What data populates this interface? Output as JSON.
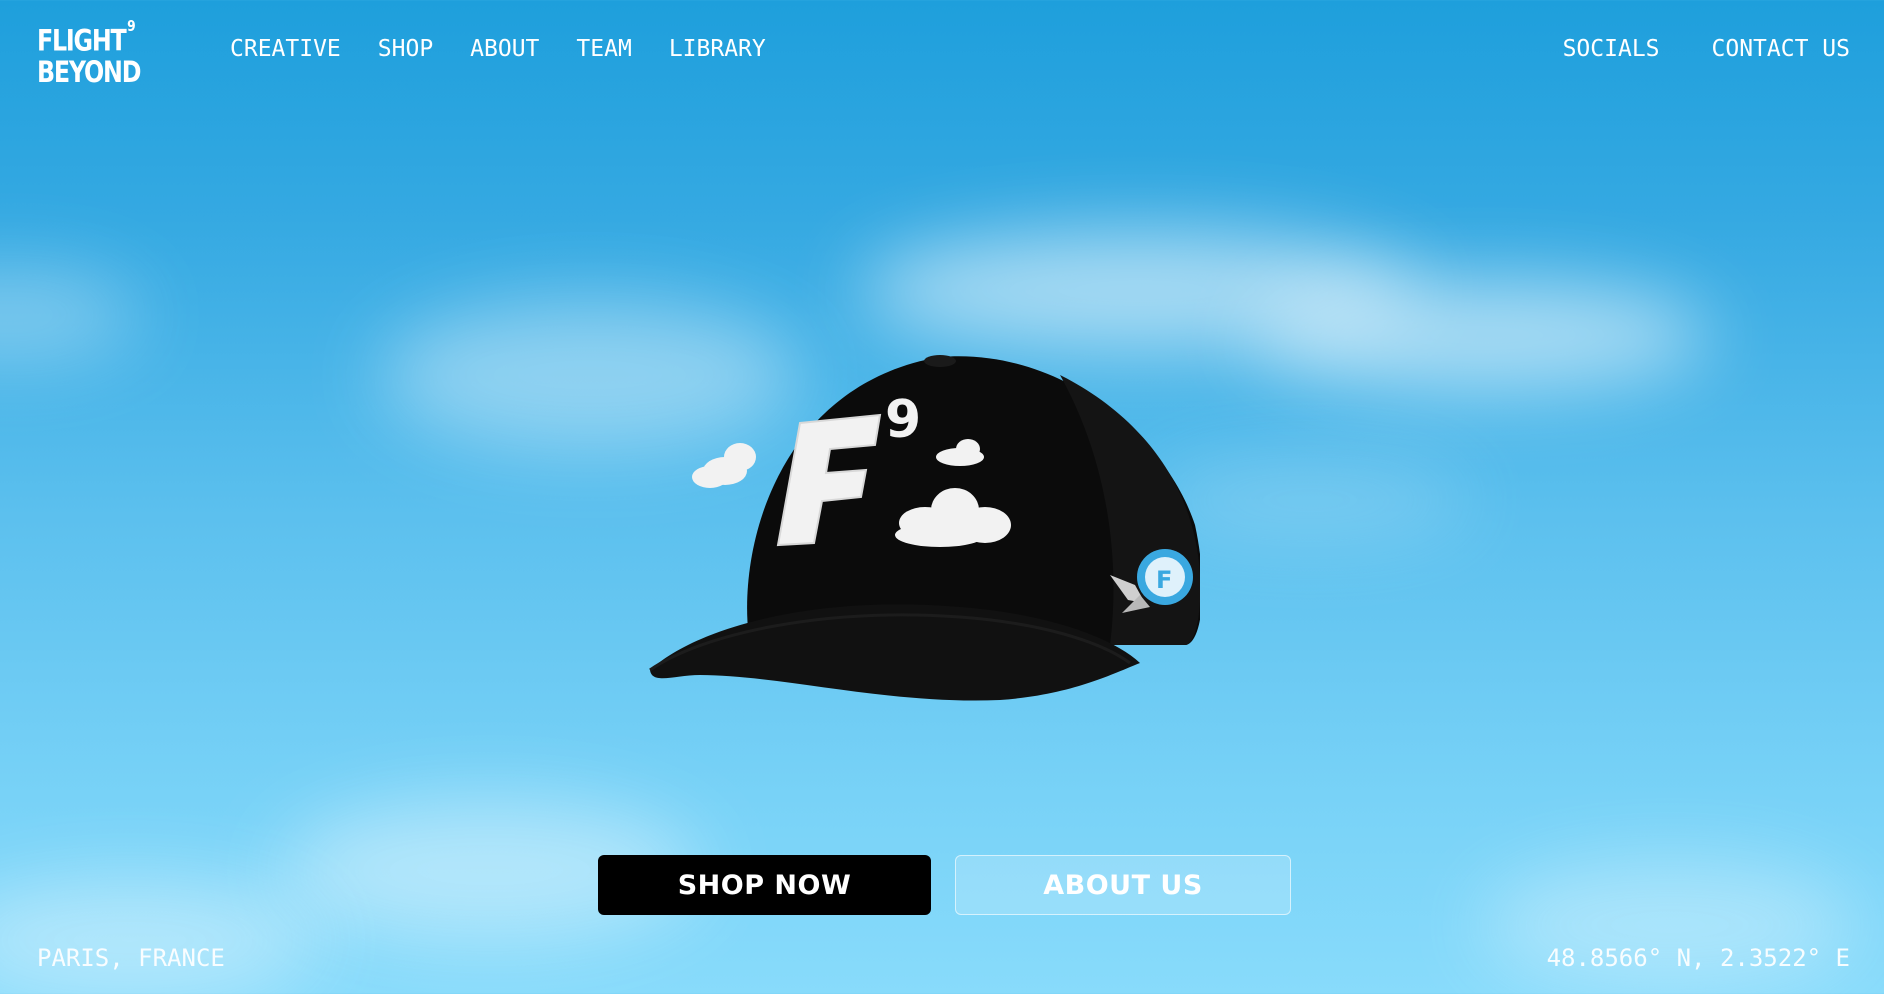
{
  "brand": {
    "logo_line1": "FLIGHT",
    "logo_sup": "9",
    "logo_line2": "BEYOND"
  },
  "nav": {
    "left": [
      "CREATIVE",
      "SHOP",
      "ABOUT",
      "TEAM",
      "LIBRARY"
    ],
    "right": [
      "SOCIALS",
      "CONTACT US"
    ]
  },
  "hero": {
    "product_icon": "f9-baseball-cap",
    "cap_color": "#0b0b0b",
    "patch_color": "#f2f2f2",
    "badge_color": "#3aa8e0"
  },
  "buttons": {
    "shop_now": "SHOP NOW",
    "about_us": "ABOUT US"
  },
  "footer": {
    "location": "PARIS, FRANCE",
    "coordinates": "48.8566° N, 2.3522° E"
  },
  "colors": {
    "sky_top": "#1e9fdc",
    "sky_bottom": "#88dbfb",
    "button_primary": "#000000"
  }
}
